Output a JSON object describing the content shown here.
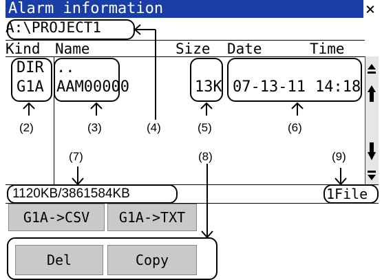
{
  "window": {
    "title": "Alarm information",
    "close_glyph": "×"
  },
  "path": "A:\\PROJECT1",
  "headers": {
    "kind": "Kind",
    "name": "Name",
    "size": "Size",
    "date": "Date",
    "time": "Time"
  },
  "rows": [
    {
      "kind": "DIR",
      "name": "..",
      "size": "",
      "date": "",
      "time": ""
    },
    {
      "kind": "G1A",
      "name": "AAM00000",
      "size": "13K",
      "date": "07-13-11",
      "time": "14:18"
    }
  ],
  "status": {
    "capacity": "1120KB/3861584KB",
    "file_count": "1File"
  },
  "buttons": {
    "csv": "G1A->CSV",
    "txt": "G1A->TXT",
    "del": "Del",
    "copy": "Copy"
  },
  "annotations": {
    "n2": "(2)",
    "n3": "(3)",
    "n4": "(4)",
    "n5": "(5)",
    "n6": "(6)",
    "n7": "(7)",
    "n8": "(8)",
    "n9": "(9)"
  },
  "scrollbar": {
    "icons": [
      "scroll-top-icon",
      "page-up-icon",
      "page-down-icon",
      "scroll-bottom-icon"
    ]
  },
  "colors": {
    "title_bar": "#1a3ea8",
    "button": "#c9c9c9"
  }
}
